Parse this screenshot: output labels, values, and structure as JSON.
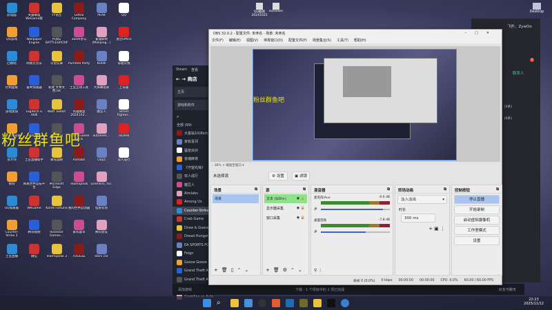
{
  "desktop": {
    "icons": [
      "此电脑",
      "英雄联盟WeGame版",
      "YY语音",
      "Lethal Company",
      "PEAK",
      "QQ",
      "QQ游戏",
      "Wallpaper Engine",
      "PUBG BATTLEGROUNDS",
      "360AI办公",
      "雀魂麻将(Mahjong...)",
      "激活Office",
      "回收站",
      "网易云音乐",
      "守望先锋",
      "Pummel Party",
      "KOOK",
      "穿越火线",
      "控制面板",
      "雷神加速器",
      "新建 文本文档.txt",
      "土豆互动工具",
      "大屏幕投屏",
      "上号器",
      "游戏加加",
      "Logitech G HUB",
      "Watt Toolkit",
      "英雄联盟 2024103...",
      "糖豆人",
      "Street Fighter...",
      "360软件管家",
      "Witch It",
      "永劫无间",
      "Goose Goose Duck",
      "autoexec...",
      "ToDesk",
      "雪大师",
      "土豆直播助手",
      "暴雪战网",
      "Aimlabs",
      "Oopz",
      "双人成行",
      "搜狗",
      "网易世界竞技平台",
      "Microsoft Edge",
      "TeamSpeak",
      "Gremlins, Inc.",
      "",
      "UU加速器",
      "WeGame",
      "Kards Fortune",
      "我的世界启动器",
      "怪兽农场",
      "",
      "Counter-Strike 2",
      "腾讯视频",
      "Rockstar Games...",
      "家有喜邻",
      "腾讯会议",
      "",
      "土豆直播",
      "微信",
      "TeamSpeak 3",
      "TOGGLE",
      "stars car",
      ""
    ],
    "overlay_text": "粉丝群鱼吧",
    "top_icons": [
      "QQ截图 20241025",
      "autoexec"
    ],
    "right_icon": "Desktop"
  },
  "steam": {
    "title": "Steam",
    "menu": "查看",
    "nav": "商店",
    "home": "主页",
    "filter": "游戏和软件",
    "all": "全部 (99)",
    "games": [
      "大富翁10(Rich...",
      "家有喜邻",
      "猛兽派对",
      "雀魂麻将",
      "《守望先锋》",
      "双人成行",
      "糖豆人",
      "Aimlabs",
      "Among Us",
      "Counter-Strike 2",
      "Crab Game",
      "Draw & Guess",
      "Dread Hunger",
      "EA SPORTS FC",
      "Feign",
      "Goose Goose Duck",
      "Grand Theft Auto V",
      "Grand Theft Auto IV",
      "Gremlins, Inc.",
      "Gremlins vs Auto"
    ],
    "add_game": "添加游戏",
    "downloads": "下载 - 1 个项目中的 1 项已完成",
    "friends": "好友与聊天"
  },
  "qq": {
    "title": "飞扑、ZywOo",
    "contacts": "联系人",
    "badge": "1",
    "group1": "[4条]",
    "group2": "[6条]"
  },
  "obs": {
    "title": "OBS 32.0.2 - 配置文件: 未命名 - 场景: 未命名",
    "menu": [
      "文件(F)",
      "编辑(E)",
      "视图(V)",
      "停靠窗口(D)",
      "配置文件(P)",
      "场景集合(S)",
      "工具(T)",
      "帮助(H)"
    ],
    "zoom": "36%",
    "zoom_mode": "缩放至窗口",
    "no_source": "未选择源",
    "settings_btn": "设置",
    "filters_btn": "滤镜",
    "scenes": {
      "title": "场景",
      "items": [
        "场景"
      ]
    },
    "sources": {
      "title": "源",
      "items": [
        "文本 (GDI+)",
        "显示器采集",
        "窗口采集"
      ]
    },
    "mixer": {
      "title": "混音器",
      "channels": [
        {
          "name": "麦克风/Aux",
          "db": "-0.6 dB",
          "volume": 0.9
        },
        {
          "name": "桌面音频",
          "db": "-7.8 dB",
          "volume": 0.65
        }
      ]
    },
    "transitions": {
      "title": "转场动画",
      "type": "淡入淡出",
      "duration_label": "时长",
      "duration": "300 ms"
    },
    "controls": {
      "title": "控制按钮",
      "buttons": [
        "停止直播",
        "开始录制",
        "启动虚拟摄像机",
        "工作室模式",
        "设置"
      ]
    },
    "status": {
      "dropped": "丢帧 0 (0.0%)",
      "kbps": "0 kbps",
      "stream_time": "00:00:00",
      "rec_time": "00:00:00",
      "cpu": "CPU: 0.0%",
      "fps": "60.00 / 60.00 FPS"
    }
  },
  "taskbar": {
    "time": "22:23",
    "date": "2025/11/12"
  },
  "colors": {
    "accent": "#a8c4ef",
    "source_active": "#8ee28a"
  }
}
